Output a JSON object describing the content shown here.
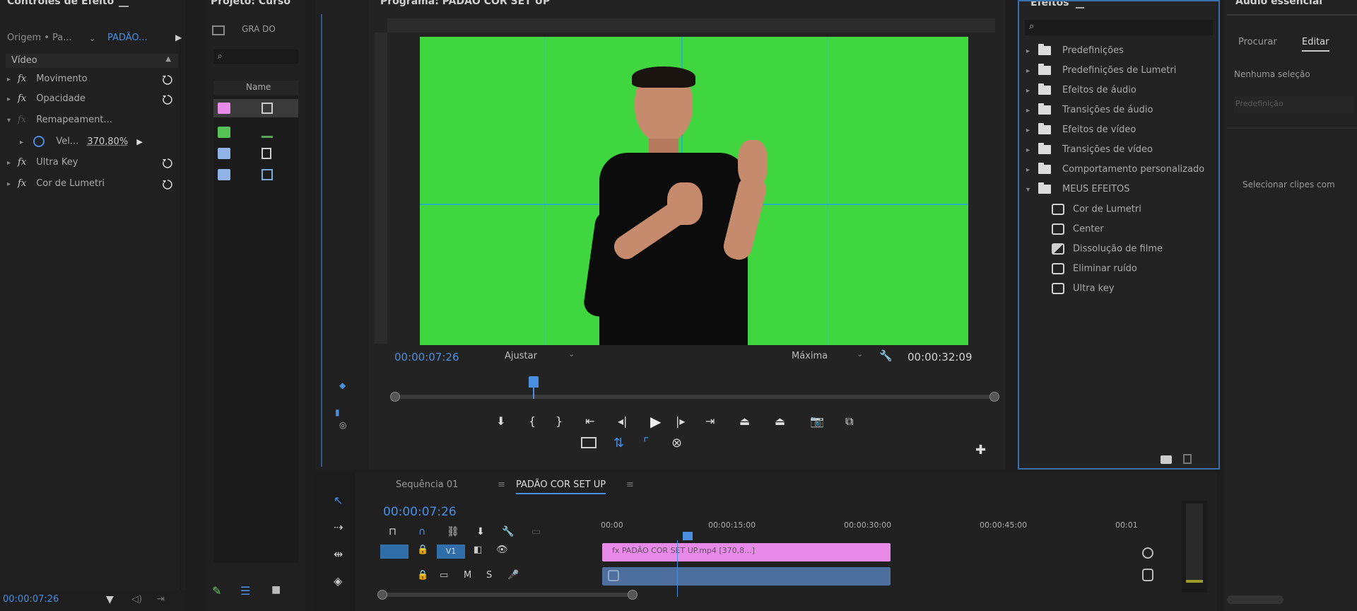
{
  "effect_controls": {
    "title": "Controles de Efeito",
    "source_label": "Origem • Pa...",
    "clip_label": "PADÃO...",
    "section_label": "Vídeo",
    "effects": [
      {
        "label": "Movimento"
      },
      {
        "label": "Opacidade"
      },
      {
        "label": "Remapeament..."
      },
      {
        "label": "Vel...",
        "value": "370,80%"
      },
      {
        "label": "Ultra Key"
      },
      {
        "label": "Cor de Lumetri"
      }
    ],
    "fx_glyph": "fx",
    "timecode": "00:00:07:26"
  },
  "project": {
    "title": "Projeto: Curso",
    "file_label": "GRA DO",
    "col_name": "Name",
    "item_colors": [
      "#e88ae8",
      "#55c255",
      "#8fb3e6",
      "#8fb3e6"
    ]
  },
  "program_monitor": {
    "title": "Programa: PADÃO COR SET UP",
    "timecode": "00:00:07:26",
    "fit_label": "Ajustar",
    "quality_label": "Máxima",
    "duration": "00:00:32:09",
    "screen_color": "#3fd63f"
  },
  "effects_panel": {
    "title": "Efeitos",
    "items": [
      {
        "label": "Predefinições",
        "kind": "folder"
      },
      {
        "label": "Predefinições de Lumetri",
        "kind": "folder"
      },
      {
        "label": "Efeitos de áudio",
        "kind": "folder"
      },
      {
        "label": "Transições de áudio",
        "kind": "folder"
      },
      {
        "label": "Efeitos de vídeo",
        "kind": "folder"
      },
      {
        "label": "Transições de vídeo",
        "kind": "folder"
      },
      {
        "label": "Comportamento personalizado",
        "kind": "folder"
      },
      {
        "label": "MEUS EFEITOS",
        "kind": "folder-open"
      },
      {
        "label": "Cor de Lumetri",
        "kind": "preset"
      },
      {
        "label": "Center",
        "kind": "preset"
      },
      {
        "label": "Dissolução de filme",
        "kind": "preset2"
      },
      {
        "label": "Eliminar ruído",
        "kind": "preset"
      },
      {
        "label": "Ultra key",
        "kind": "preset"
      }
    ]
  },
  "essential_sound": {
    "title": "Áudio essencial",
    "tab_browse": "Procurar",
    "tab_edit": "Editar",
    "no_selection": "Nenhuma seleção",
    "preset_label": "Predefinição",
    "select_clips": "Selecionar clipes com"
  },
  "timeline": {
    "tab_sequence": "Sequência 01",
    "tab_active": "PADÃO COR SET UP",
    "timecode": "00:00:07:26",
    "ruler_labels": [
      "00:00",
      "00:00:15:00",
      "00:00:30:00",
      "00:00:45:00",
      "00:01"
    ],
    "track_v1": "V1",
    "clip_label": "fx  PADÃO COR SET UP.mp4 [370,8...]",
    "clip_color": "#e88ae8",
    "audio_clip_color": "#4d6f9e"
  }
}
